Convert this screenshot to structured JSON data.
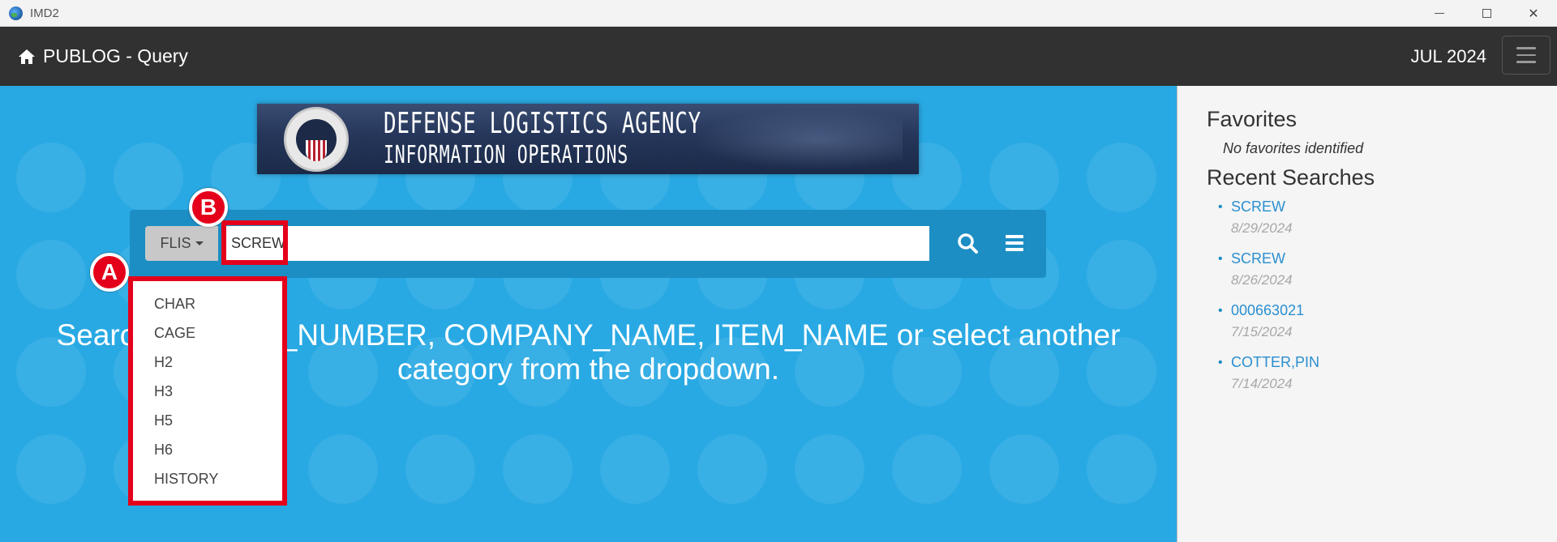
{
  "window": {
    "title": "IMD2"
  },
  "navbar": {
    "brand": "PUBLOG - Query",
    "date": "JUL 2024"
  },
  "banner": {
    "line1": "DEFENSE LOGISTICS AGENCY",
    "line2": "INFORMATION OPERATIONS"
  },
  "search": {
    "category_label": "FLIS",
    "query_value": "SCREW"
  },
  "dropdown": {
    "options": [
      "CHAR",
      "CAGE",
      "H2",
      "H3",
      "H5",
      "H6",
      "HISTORY"
    ]
  },
  "hint": "Search for PART_NUMBER, COMPANY_NAME, ITEM_NAME or select another category from the dropdown.",
  "annotations": {
    "a": "A",
    "b": "B",
    "color": "#e4001b"
  },
  "sidebar": {
    "favorites_title": "Favorites",
    "favorites_empty": "No favorites identified",
    "recent_title": "Recent Searches",
    "recent": [
      {
        "term": "SCREW",
        "date": "8/29/2024"
      },
      {
        "term": "SCREW",
        "date": "8/26/2024"
      },
      {
        "term": "000663021",
        "date": "7/15/2024"
      },
      {
        "term": "COTTER,PIN",
        "date": "7/14/2024"
      }
    ]
  },
  "colors": {
    "main_bg": "#29a9e3",
    "navbar_bg": "#313131",
    "link": "#2a8fd0"
  }
}
